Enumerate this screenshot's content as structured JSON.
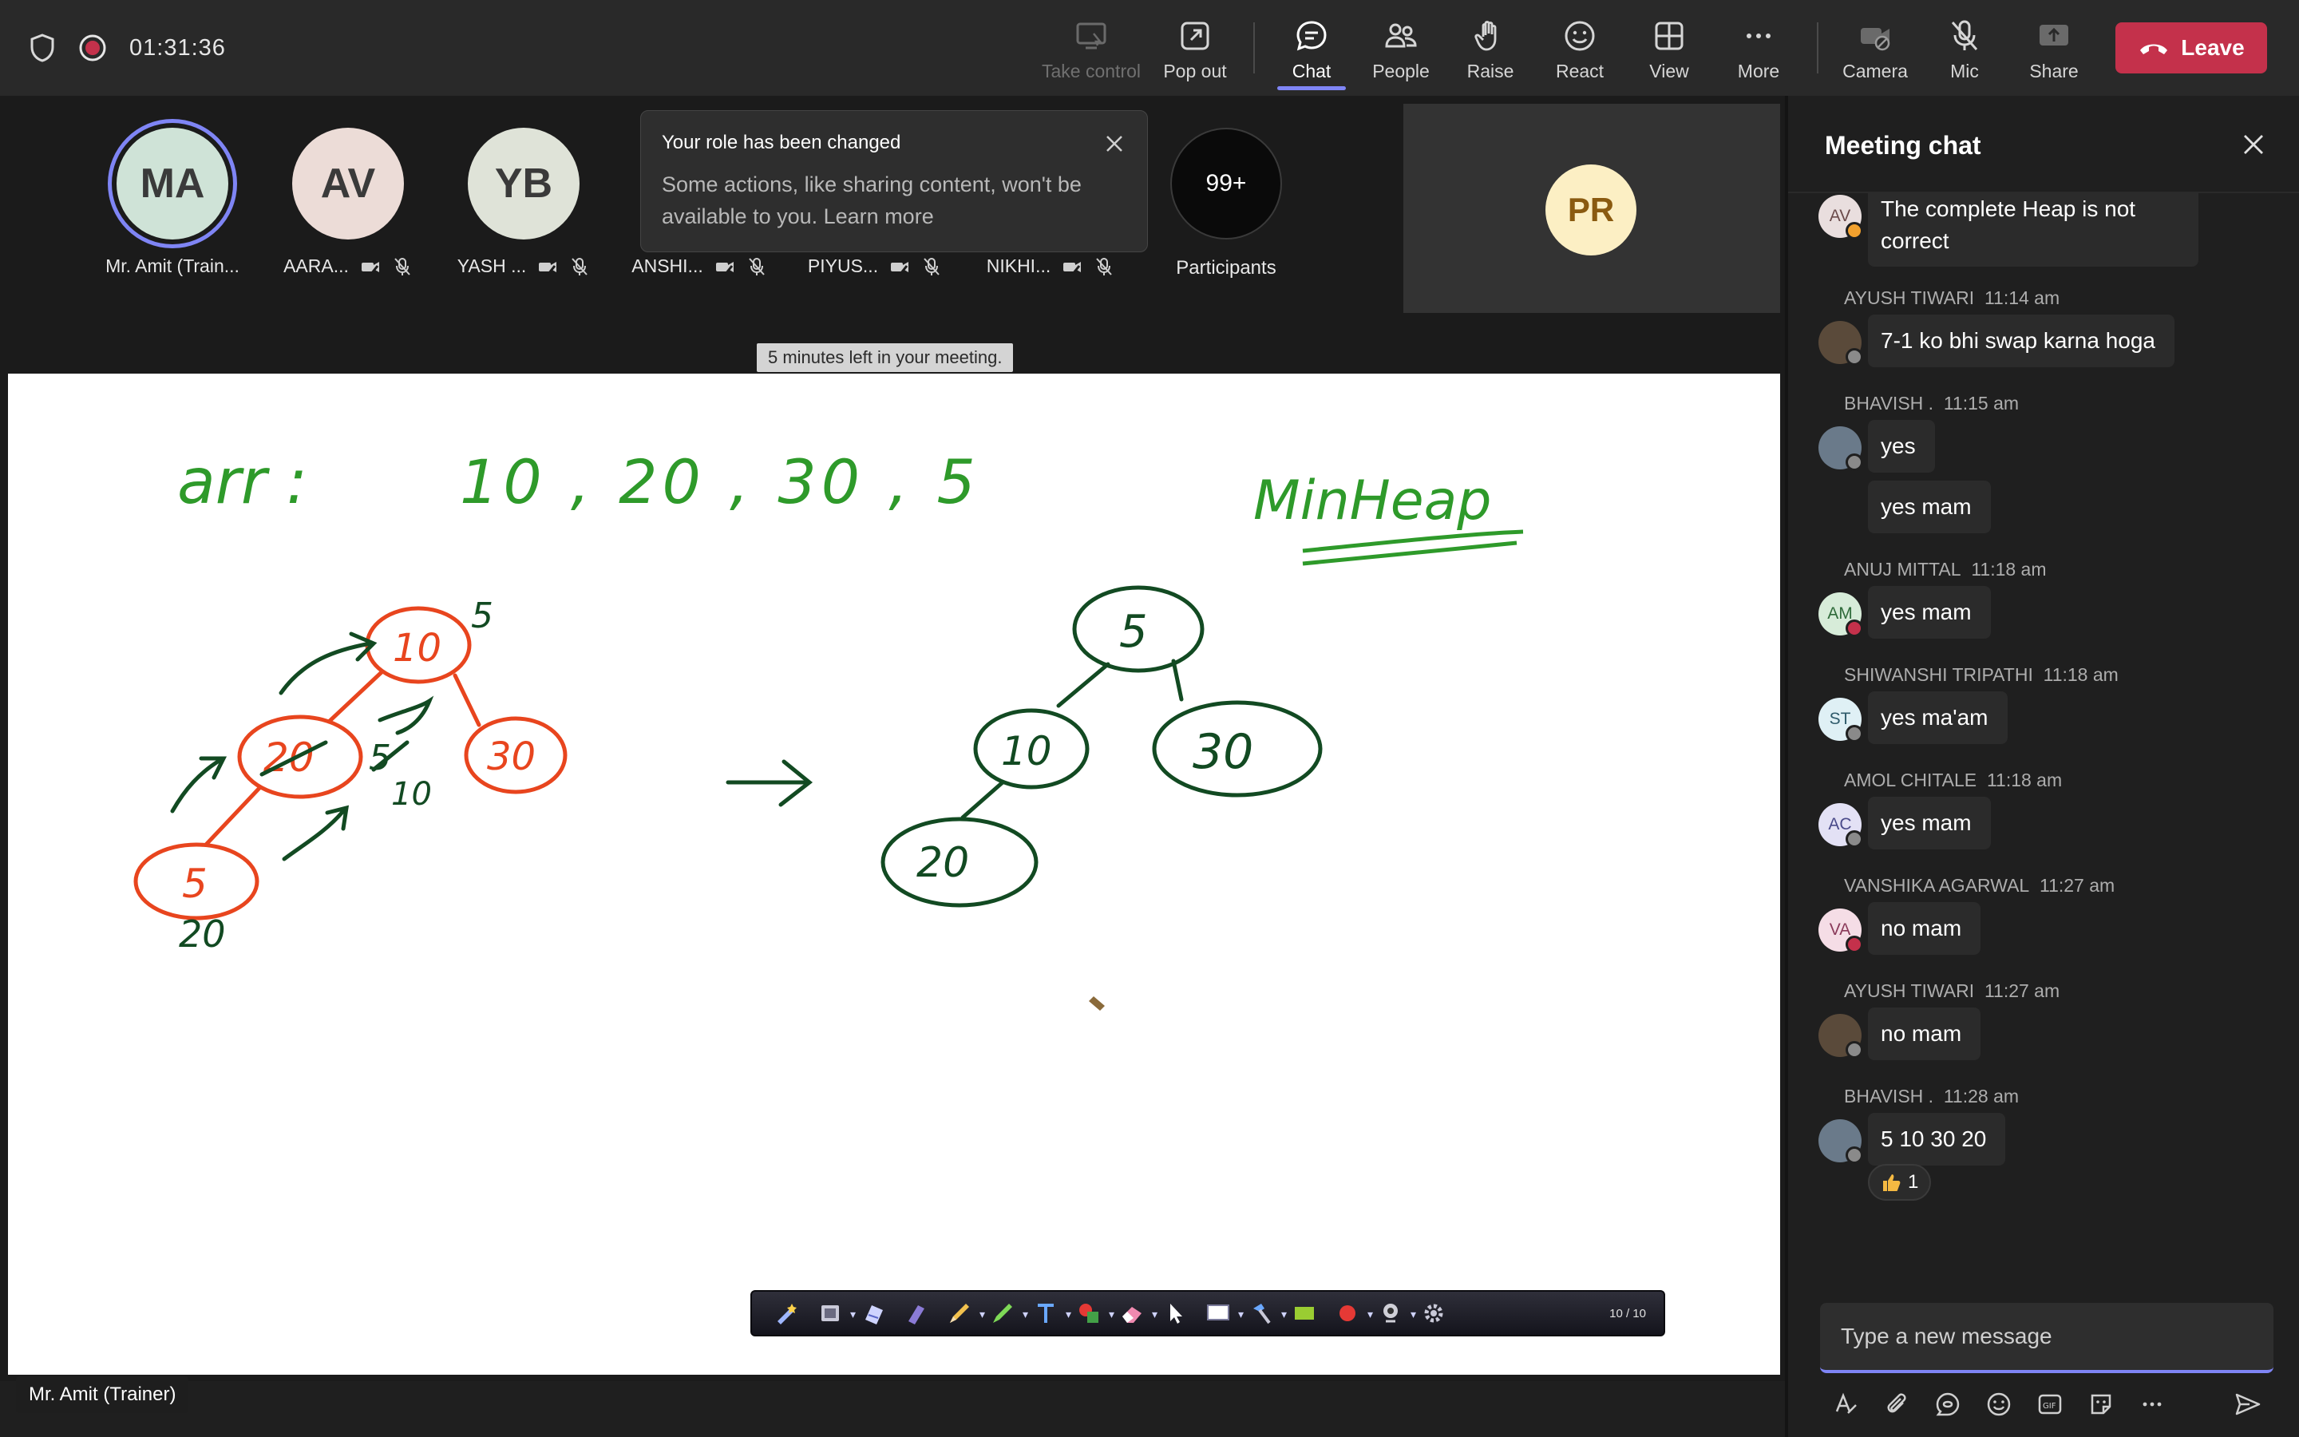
{
  "topbar": {
    "timer": "01:31:36",
    "buttons": {
      "take_control": "Take control",
      "pop_out": "Pop out",
      "chat": "Chat",
      "people": "People",
      "raise": "Raise",
      "react": "React",
      "view": "View",
      "more": "More",
      "camera": "Camera",
      "mic": "Mic",
      "share": "Share"
    },
    "leave": "Leave",
    "accent_color": "#7f85f5",
    "leave_color": "#c4314b"
  },
  "participants": [
    {
      "initials": "MA",
      "name": "Mr. Amit (Train...",
      "color": "#cfe3d7"
    },
    {
      "initials": "AV",
      "name": "AARA...",
      "color": "#ecdcd7"
    },
    {
      "initials": "YB",
      "name": "YASH ...",
      "color": "#dfe3d8"
    },
    {
      "initials": "",
      "name": "ANSHI..."
    },
    {
      "initials": "",
      "name": "PIYUS..."
    },
    {
      "initials": "",
      "name": "NIKHI..."
    }
  ],
  "participants_count": "99+",
  "participants_label": "Participants",
  "spotlight": {
    "initials": "PR"
  },
  "toast": {
    "title": "Your role has been changed",
    "body": "Some actions, like sharing content, won't be available to you. Learn more"
  },
  "notice": "5 minutes left in your meeting.",
  "presenter": "Mr. Amit (Trainer)",
  "whiteboard": {
    "array_label": "arr :",
    "array_values": "10 , 20 , 30 , 5",
    "heading": "MinHeap",
    "page": "10 / 10"
  },
  "chat": {
    "title": "Meeting chat",
    "messages": [
      {
        "initials": "AV",
        "author": "",
        "time": "",
        "text": "The complete Heap is not correct",
        "text2": "correct"
      },
      {
        "initials": "",
        "author": "AYUSH TIWARI",
        "time": "11:14 am",
        "text": "7-1 ko bhi swap karna hoga"
      },
      {
        "initials": "",
        "author": "BHAVISH .",
        "time": "11:15 am",
        "text": "yes",
        "text_b": "yes mam"
      },
      {
        "initials": "AM",
        "author": "ANUJ MITTAL",
        "time": "11:18 am",
        "text": "yes mam"
      },
      {
        "initials": "ST",
        "author": "SHIWANSHI TRIPATHI",
        "time": "11:18 am",
        "text": "yes ma'am"
      },
      {
        "initials": "AC",
        "author": "AMOL CHITALE",
        "time": "11:18 am",
        "text": "yes mam"
      },
      {
        "initials": "VA",
        "author": "VANSHIKA AGARWAL",
        "time": "11:27 am",
        "text": "no mam"
      },
      {
        "initials": "",
        "author": "AYUSH TIWARI",
        "time": "11:27 am",
        "text": "no mam"
      },
      {
        "initials": "",
        "author": "BHAVISH .",
        "time": "11:28 am",
        "text": "5 10 30 20"
      }
    ],
    "reaction_count": "1",
    "compose_placeholder": "Type a new message"
  }
}
